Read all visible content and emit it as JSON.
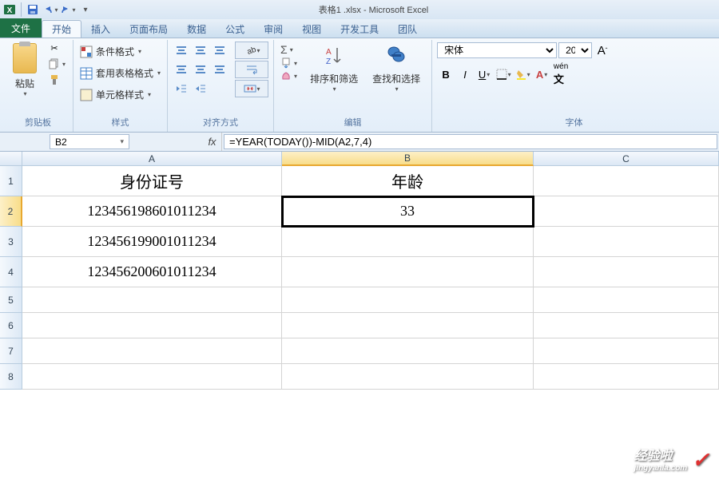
{
  "titlebar": {
    "doc_title": "表格1 .xlsx - Microsoft Excel"
  },
  "tabs": {
    "file": "文件",
    "home": "开始",
    "insert": "插入",
    "layout": "页面布局",
    "data": "数据",
    "formulas": "公式",
    "review": "审阅",
    "view": "视图",
    "dev": "开发工具",
    "team": "团队"
  },
  "ribbon": {
    "paste_label": "粘贴",
    "clipboard_group": "剪贴板",
    "cond_fmt": "条件格式",
    "table_fmt": "套用表格格式",
    "cell_style": "单元格样式",
    "style_group": "样式",
    "align_group": "对齐方式",
    "edit_group": "编辑",
    "sort_filter": "排序和筛选",
    "find_select": "查找和选择",
    "font_name": "宋体",
    "font_size": "20",
    "font_group": "字体"
  },
  "formula_bar": {
    "name_box": "B2",
    "fx": "fx",
    "formula": "=YEAR(TODAY())-MID(A2,7,4)"
  },
  "columns": {
    "A": "A",
    "B": "B",
    "C": "C"
  },
  "rows": [
    "1",
    "2",
    "3",
    "4",
    "5",
    "6",
    "7",
    "8"
  ],
  "cells": {
    "A1": "身份证号",
    "B1": "年龄",
    "A2": "123456198601011234",
    "B2": "33",
    "A3": "123456199001011234",
    "A4": "123456200601011234"
  },
  "watermark": {
    "main": "经验啦",
    "sub": "jingyanla.com",
    "check": "✓"
  }
}
